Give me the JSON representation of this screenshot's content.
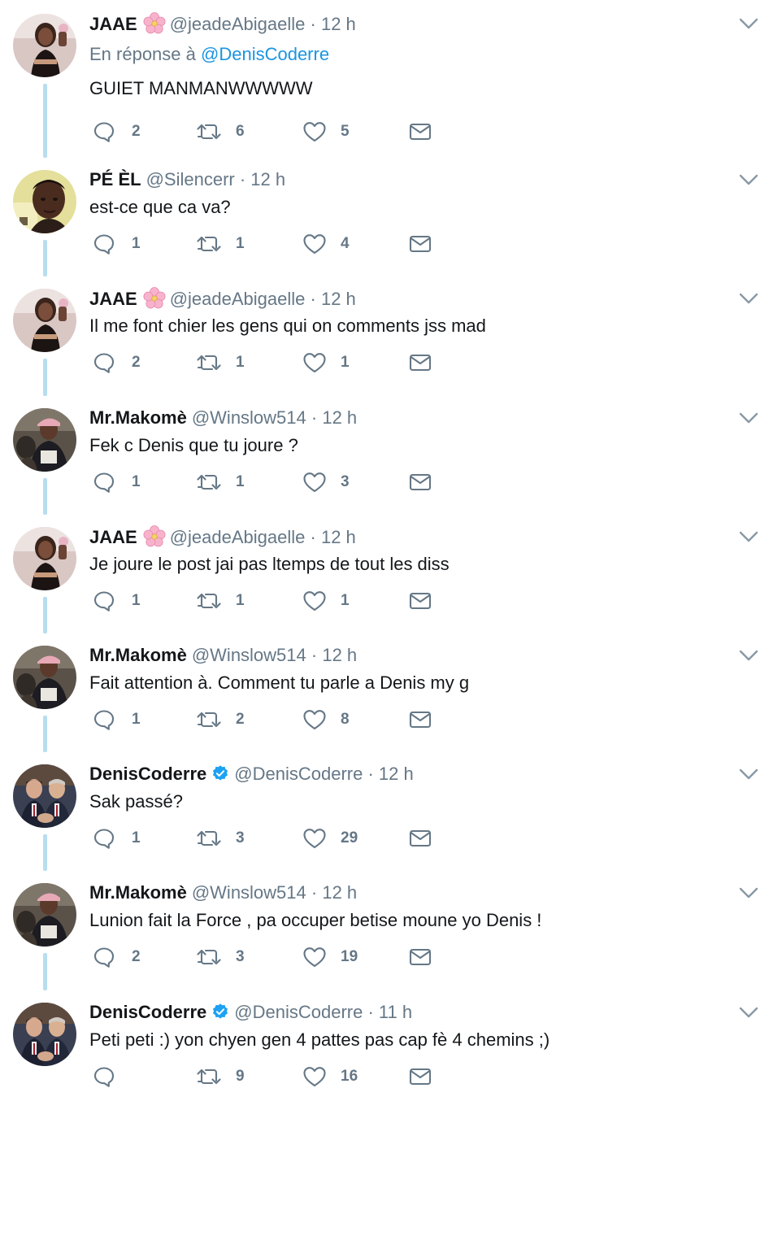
{
  "tweets": [
    {
      "name": "JAAE",
      "emoji": "cherry-blossom-icon",
      "handle": "@jeadeAbigaelle",
      "sep": "·",
      "time": "12 h",
      "reply_prefix": "En réponse à",
      "reply_mention": "@DenisCoderre",
      "text": "GUIET MANMANWWWWW",
      "replies": "2",
      "retweets": "6",
      "likes": "5",
      "avatar": "jaae"
    },
    {
      "name": "PÉ ÈL",
      "handle": "@Silencerr",
      "sep": "·",
      "time": "12 h",
      "text": "est-ce que ca va?",
      "replies": "1",
      "retweets": "1",
      "likes": "4",
      "avatar": "peel"
    },
    {
      "name": "JAAE",
      "emoji": "cherry-blossom-icon",
      "handle": "@jeadeAbigaelle",
      "sep": "·",
      "time": "12 h",
      "text": "Il me font chier les gens qui on comments jss mad",
      "replies": "2",
      "retweets": "1",
      "likes": "1",
      "avatar": "jaae"
    },
    {
      "name": "Mr.Makomè",
      "handle": "@Winslow514",
      "sep": "·",
      "time": "12 h",
      "text": "Fek c Denis que tu joure ?",
      "replies": "1",
      "retweets": "1",
      "likes": "3",
      "avatar": "makome"
    },
    {
      "name": "JAAE",
      "emoji": "cherry-blossom-icon",
      "handle": "@jeadeAbigaelle",
      "sep": "·",
      "time": "12 h",
      "text": "Je joure le post jai pas ltemps de tout les diss",
      "replies": "1",
      "retweets": "1",
      "likes": "1",
      "avatar": "jaae"
    },
    {
      "name": "Mr.Makomè",
      "handle": "@Winslow514",
      "sep": "·",
      "time": "12 h",
      "text": "Fait attention à. Comment tu parle a Denis my g",
      "replies": "1",
      "retweets": "2",
      "likes": "8",
      "avatar": "makome"
    },
    {
      "name": "DenisCoderre",
      "verified": true,
      "handle": "@DenisCoderre",
      "sep": "·",
      "time": "12 h",
      "text": "Sak passé?",
      "replies": "1",
      "retweets": "3",
      "likes": "29",
      "avatar": "denis"
    },
    {
      "name": "Mr.Makomè",
      "handle": "@Winslow514",
      "sep": "·",
      "time": "12 h",
      "text": "Lunion fait la Force , pa occuper betise moune yo Denis !",
      "replies": "2",
      "retweets": "3",
      "likes": "19",
      "avatar": "makome"
    },
    {
      "name": "DenisCoderre",
      "verified": true,
      "handle": "@DenisCoderre",
      "sep": "·",
      "time": "11 h",
      "text": "Peti peti :) yon chyen gen 4 pattes pas cap fè 4 chemins ;)",
      "replies": "",
      "retweets": "9",
      "likes": "16",
      "avatar": "denis"
    }
  ],
  "colors": {
    "text": "#14171a",
    "secondary": "#657786",
    "link": "#1b95e0",
    "thread_line": "#b8ddf0",
    "verified": "#1da1f2",
    "flower": "#f4a6c4"
  },
  "icons": {
    "reply": "reply-bubble-icon",
    "retweet": "retweet-icon",
    "like": "heart-icon",
    "dm": "envelope-icon",
    "more": "chevron-down-icon",
    "verified": "verified-badge-icon"
  }
}
